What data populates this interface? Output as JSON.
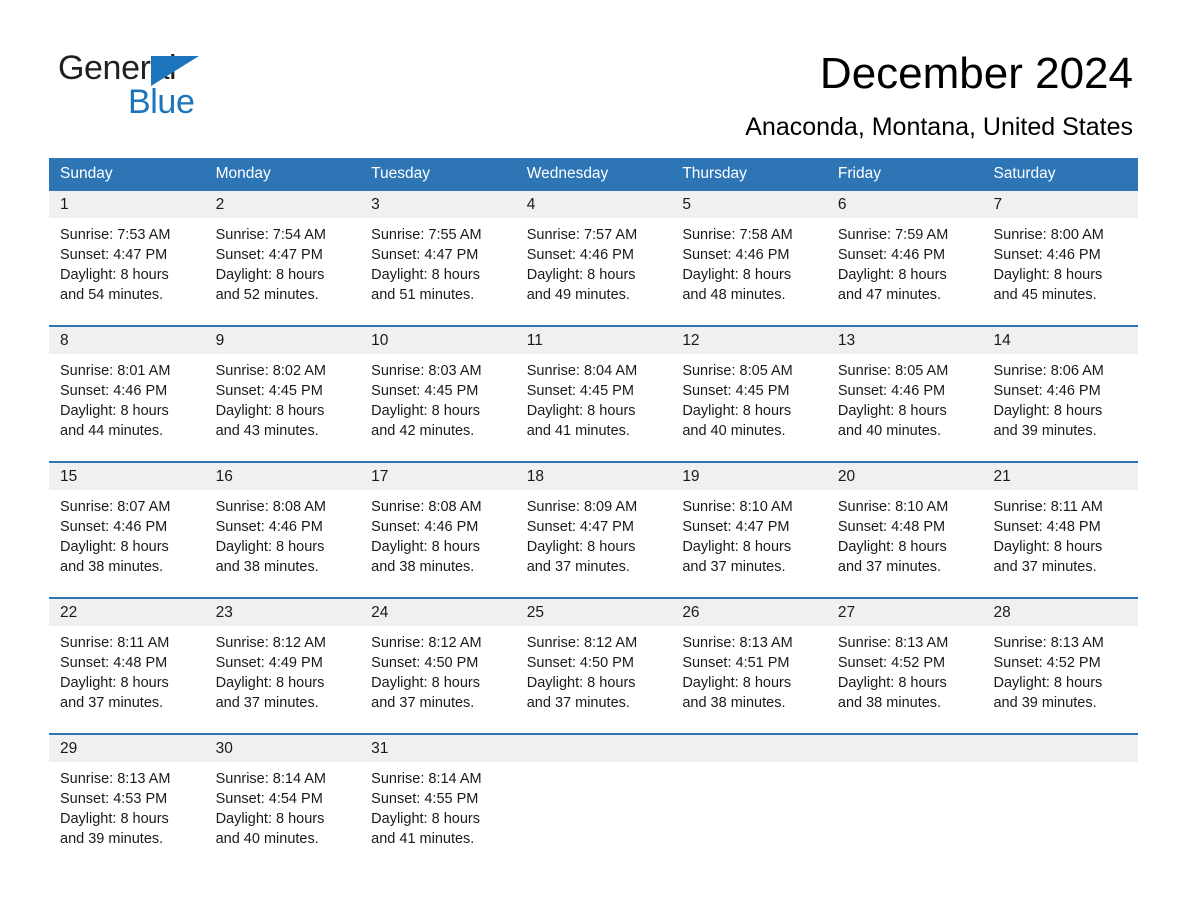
{
  "brand": {
    "name_part1": "General",
    "name_part2": "Blue",
    "accent_color": "#1c75bc"
  },
  "header": {
    "title": "December 2024",
    "subtitle": "Anaconda, Montana, United States"
  },
  "calendar": {
    "header_background": "#2e75b6",
    "daynum_background": "#f0f0f0",
    "weekday_headers": [
      "Sunday",
      "Monday",
      "Tuesday",
      "Wednesday",
      "Thursday",
      "Friday",
      "Saturday"
    ],
    "weeks": [
      [
        {
          "day": "1",
          "sunrise": "Sunrise: 7:53 AM",
          "sunset": "Sunset: 4:47 PM",
          "daylight_line1": "Daylight: 8 hours",
          "daylight_line2": "and 54 minutes."
        },
        {
          "day": "2",
          "sunrise": "Sunrise: 7:54 AM",
          "sunset": "Sunset: 4:47 PM",
          "daylight_line1": "Daylight: 8 hours",
          "daylight_line2": "and 52 minutes."
        },
        {
          "day": "3",
          "sunrise": "Sunrise: 7:55 AM",
          "sunset": "Sunset: 4:47 PM",
          "daylight_line1": "Daylight: 8 hours",
          "daylight_line2": "and 51 minutes."
        },
        {
          "day": "4",
          "sunrise": "Sunrise: 7:57 AM",
          "sunset": "Sunset: 4:46 PM",
          "daylight_line1": "Daylight: 8 hours",
          "daylight_line2": "and 49 minutes."
        },
        {
          "day": "5",
          "sunrise": "Sunrise: 7:58 AM",
          "sunset": "Sunset: 4:46 PM",
          "daylight_line1": "Daylight: 8 hours",
          "daylight_line2": "and 48 minutes."
        },
        {
          "day": "6",
          "sunrise": "Sunrise: 7:59 AM",
          "sunset": "Sunset: 4:46 PM",
          "daylight_line1": "Daylight: 8 hours",
          "daylight_line2": "and 47 minutes."
        },
        {
          "day": "7",
          "sunrise": "Sunrise: 8:00 AM",
          "sunset": "Sunset: 4:46 PM",
          "daylight_line1": "Daylight: 8 hours",
          "daylight_line2": "and 45 minutes."
        }
      ],
      [
        {
          "day": "8",
          "sunrise": "Sunrise: 8:01 AM",
          "sunset": "Sunset: 4:46 PM",
          "daylight_line1": "Daylight: 8 hours",
          "daylight_line2": "and 44 minutes."
        },
        {
          "day": "9",
          "sunrise": "Sunrise: 8:02 AM",
          "sunset": "Sunset: 4:45 PM",
          "daylight_line1": "Daylight: 8 hours",
          "daylight_line2": "and 43 minutes."
        },
        {
          "day": "10",
          "sunrise": "Sunrise: 8:03 AM",
          "sunset": "Sunset: 4:45 PM",
          "daylight_line1": "Daylight: 8 hours",
          "daylight_line2": "and 42 minutes."
        },
        {
          "day": "11",
          "sunrise": "Sunrise: 8:04 AM",
          "sunset": "Sunset: 4:45 PM",
          "daylight_line1": "Daylight: 8 hours",
          "daylight_line2": "and 41 minutes."
        },
        {
          "day": "12",
          "sunrise": "Sunrise: 8:05 AM",
          "sunset": "Sunset: 4:45 PM",
          "daylight_line1": "Daylight: 8 hours",
          "daylight_line2": "and 40 minutes."
        },
        {
          "day": "13",
          "sunrise": "Sunrise: 8:05 AM",
          "sunset": "Sunset: 4:46 PM",
          "daylight_line1": "Daylight: 8 hours",
          "daylight_line2": "and 40 minutes."
        },
        {
          "day": "14",
          "sunrise": "Sunrise: 8:06 AM",
          "sunset": "Sunset: 4:46 PM",
          "daylight_line1": "Daylight: 8 hours",
          "daylight_line2": "and 39 minutes."
        }
      ],
      [
        {
          "day": "15",
          "sunrise": "Sunrise: 8:07 AM",
          "sunset": "Sunset: 4:46 PM",
          "daylight_line1": "Daylight: 8 hours",
          "daylight_line2": "and 38 minutes."
        },
        {
          "day": "16",
          "sunrise": "Sunrise: 8:08 AM",
          "sunset": "Sunset: 4:46 PM",
          "daylight_line1": "Daylight: 8 hours",
          "daylight_line2": "and 38 minutes."
        },
        {
          "day": "17",
          "sunrise": "Sunrise: 8:08 AM",
          "sunset": "Sunset: 4:46 PM",
          "daylight_line1": "Daylight: 8 hours",
          "daylight_line2": "and 38 minutes."
        },
        {
          "day": "18",
          "sunrise": "Sunrise: 8:09 AM",
          "sunset": "Sunset: 4:47 PM",
          "daylight_line1": "Daylight: 8 hours",
          "daylight_line2": "and 37 minutes."
        },
        {
          "day": "19",
          "sunrise": "Sunrise: 8:10 AM",
          "sunset": "Sunset: 4:47 PM",
          "daylight_line1": "Daylight: 8 hours",
          "daylight_line2": "and 37 minutes."
        },
        {
          "day": "20",
          "sunrise": "Sunrise: 8:10 AM",
          "sunset": "Sunset: 4:48 PM",
          "daylight_line1": "Daylight: 8 hours",
          "daylight_line2": "and 37 minutes."
        },
        {
          "day": "21",
          "sunrise": "Sunrise: 8:11 AM",
          "sunset": "Sunset: 4:48 PM",
          "daylight_line1": "Daylight: 8 hours",
          "daylight_line2": "and 37 minutes."
        }
      ],
      [
        {
          "day": "22",
          "sunrise": "Sunrise: 8:11 AM",
          "sunset": "Sunset: 4:48 PM",
          "daylight_line1": "Daylight: 8 hours",
          "daylight_line2": "and 37 minutes."
        },
        {
          "day": "23",
          "sunrise": "Sunrise: 8:12 AM",
          "sunset": "Sunset: 4:49 PM",
          "daylight_line1": "Daylight: 8 hours",
          "daylight_line2": "and 37 minutes."
        },
        {
          "day": "24",
          "sunrise": "Sunrise: 8:12 AM",
          "sunset": "Sunset: 4:50 PM",
          "daylight_line1": "Daylight: 8 hours",
          "daylight_line2": "and 37 minutes."
        },
        {
          "day": "25",
          "sunrise": "Sunrise: 8:12 AM",
          "sunset": "Sunset: 4:50 PM",
          "daylight_line1": "Daylight: 8 hours",
          "daylight_line2": "and 37 minutes."
        },
        {
          "day": "26",
          "sunrise": "Sunrise: 8:13 AM",
          "sunset": "Sunset: 4:51 PM",
          "daylight_line1": "Daylight: 8 hours",
          "daylight_line2": "and 38 minutes."
        },
        {
          "day": "27",
          "sunrise": "Sunrise: 8:13 AM",
          "sunset": "Sunset: 4:52 PM",
          "daylight_line1": "Daylight: 8 hours",
          "daylight_line2": "and 38 minutes."
        },
        {
          "day": "28",
          "sunrise": "Sunrise: 8:13 AM",
          "sunset": "Sunset: 4:52 PM",
          "daylight_line1": "Daylight: 8 hours",
          "daylight_line2": "and 39 minutes."
        }
      ],
      [
        {
          "day": "29",
          "sunrise": "Sunrise: 8:13 AM",
          "sunset": "Sunset: 4:53 PM",
          "daylight_line1": "Daylight: 8 hours",
          "daylight_line2": "and 39 minutes."
        },
        {
          "day": "30",
          "sunrise": "Sunrise: 8:14 AM",
          "sunset": "Sunset: 4:54 PM",
          "daylight_line1": "Daylight: 8 hours",
          "daylight_line2": "and 40 minutes."
        },
        {
          "day": "31",
          "sunrise": "Sunrise: 8:14 AM",
          "sunset": "Sunset: 4:55 PM",
          "daylight_line1": "Daylight: 8 hours",
          "daylight_line2": "and 41 minutes."
        },
        {
          "day": "",
          "sunrise": "",
          "sunset": "",
          "daylight_line1": "",
          "daylight_line2": ""
        },
        {
          "day": "",
          "sunrise": "",
          "sunset": "",
          "daylight_line1": "",
          "daylight_line2": ""
        },
        {
          "day": "",
          "sunrise": "",
          "sunset": "",
          "daylight_line1": "",
          "daylight_line2": ""
        },
        {
          "day": "",
          "sunrise": "",
          "sunset": "",
          "daylight_line1": "",
          "daylight_line2": ""
        }
      ]
    ]
  }
}
